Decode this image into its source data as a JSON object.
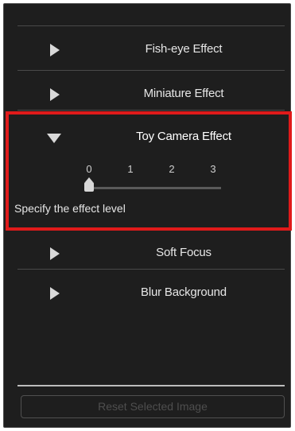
{
  "effects": [
    {
      "label": "Fish-eye Effect",
      "expanded": false
    },
    {
      "label": "Miniature Effect",
      "expanded": false
    },
    {
      "label": "Toy Camera Effect",
      "expanded": true
    },
    {
      "label": "Soft Focus",
      "expanded": false
    },
    {
      "label": "Blur Background",
      "expanded": false
    }
  ],
  "level_slider": {
    "ticks": [
      "0",
      "1",
      "2",
      "3"
    ],
    "value": 0,
    "description": "Specify the effect level"
  },
  "reset_button": {
    "label": "Reset Selected Image",
    "enabled": false
  },
  "colors": {
    "panel_bg": "#1e1e1e",
    "highlight": "#e01a1a",
    "text": "#e6e6e6",
    "disabled_text": "#4e4e4e"
  }
}
